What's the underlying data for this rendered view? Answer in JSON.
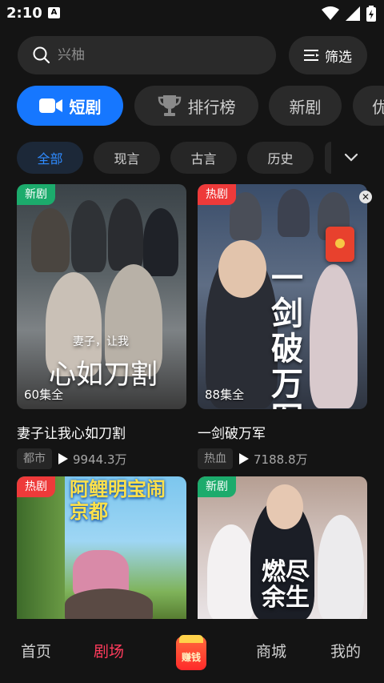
{
  "status_bar": {
    "time": "2:10",
    "app_icon_letter": "A"
  },
  "search": {
    "placeholder": "兴柚"
  },
  "filter": {
    "label": "筛选"
  },
  "tabs": [
    {
      "label": "短剧",
      "active": true
    },
    {
      "label": "排行榜",
      "active": false
    },
    {
      "label": "新剧",
      "active": false
    },
    {
      "label": "优",
      "active": false
    }
  ],
  "chips": [
    {
      "label": "全部",
      "active": true
    },
    {
      "label": "现言",
      "active": false
    },
    {
      "label": "古言",
      "active": false
    },
    {
      "label": "历史",
      "active": false
    }
  ],
  "cards": [
    {
      "badge": "新剧",
      "badge_type": "new",
      "episodes": "60集全",
      "poster_text_small": "妻子，让我",
      "poster_text_big": "心如刀割",
      "title": "妻子让我心如刀割",
      "tag": "都市",
      "views": "9944.3万"
    },
    {
      "badge": "热剧",
      "badge_type": "hot",
      "episodes": "88集全",
      "poster_text_big": "一剑破万军",
      "title": "一剑破万军",
      "tag": "热血",
      "views": "7188.8万"
    },
    {
      "badge": "热剧",
      "badge_type": "hot",
      "poster_text_big": "阿鲤明宝闹京都"
    },
    {
      "badge": "新剧",
      "badge_type": "new",
      "poster_text_big": "燃尽余生"
    }
  ],
  "bottom_nav": {
    "home": "首页",
    "theater": "剧场",
    "earn": "赚钱",
    "mall": "商城",
    "mine": "我的"
  },
  "colors": {
    "accent_blue": "#1677ff",
    "active_nav": "#ff3b5c",
    "badge_new": "#1cab6c",
    "badge_hot": "#ee3a3a"
  }
}
